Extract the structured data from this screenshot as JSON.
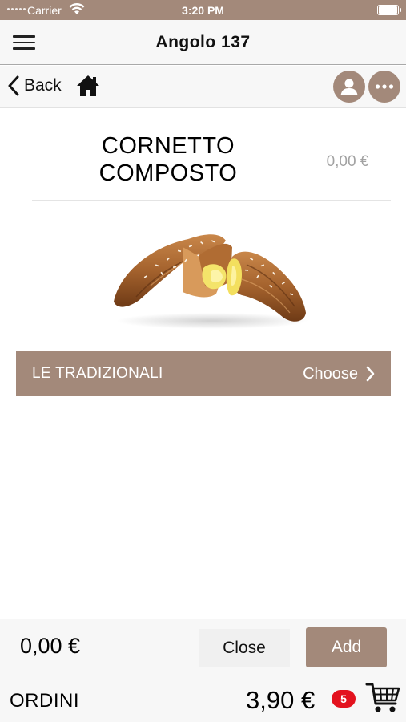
{
  "status_bar": {
    "carrier": "Carrier",
    "time": "3:20 PM"
  },
  "nav": {
    "title": "Angolo 137"
  },
  "sub_nav": {
    "back_label": "Back"
  },
  "product": {
    "title_line1": "CORNETTO",
    "title_line2": "COMPOSTO",
    "price": "0,00 €"
  },
  "category": {
    "name": "LE TRADIZIONALI",
    "choose_label": "Choose"
  },
  "bottom": {
    "total": "0,00 €",
    "close_label": "Close",
    "add_label": "Add"
  },
  "orders": {
    "label": "ORDINI",
    "total": "3,90 €",
    "count": "5"
  },
  "icons": [
    "hamburger-menu-icon",
    "chevron-left-icon",
    "home-icon",
    "user-icon",
    "more-icon",
    "chevron-right-icon",
    "cart-icon",
    "wifi-icon",
    "battery-icon"
  ],
  "colors": {
    "accent": "#a3897a",
    "badge": "#e3121e",
    "price_muted": "#a2a2a2"
  }
}
